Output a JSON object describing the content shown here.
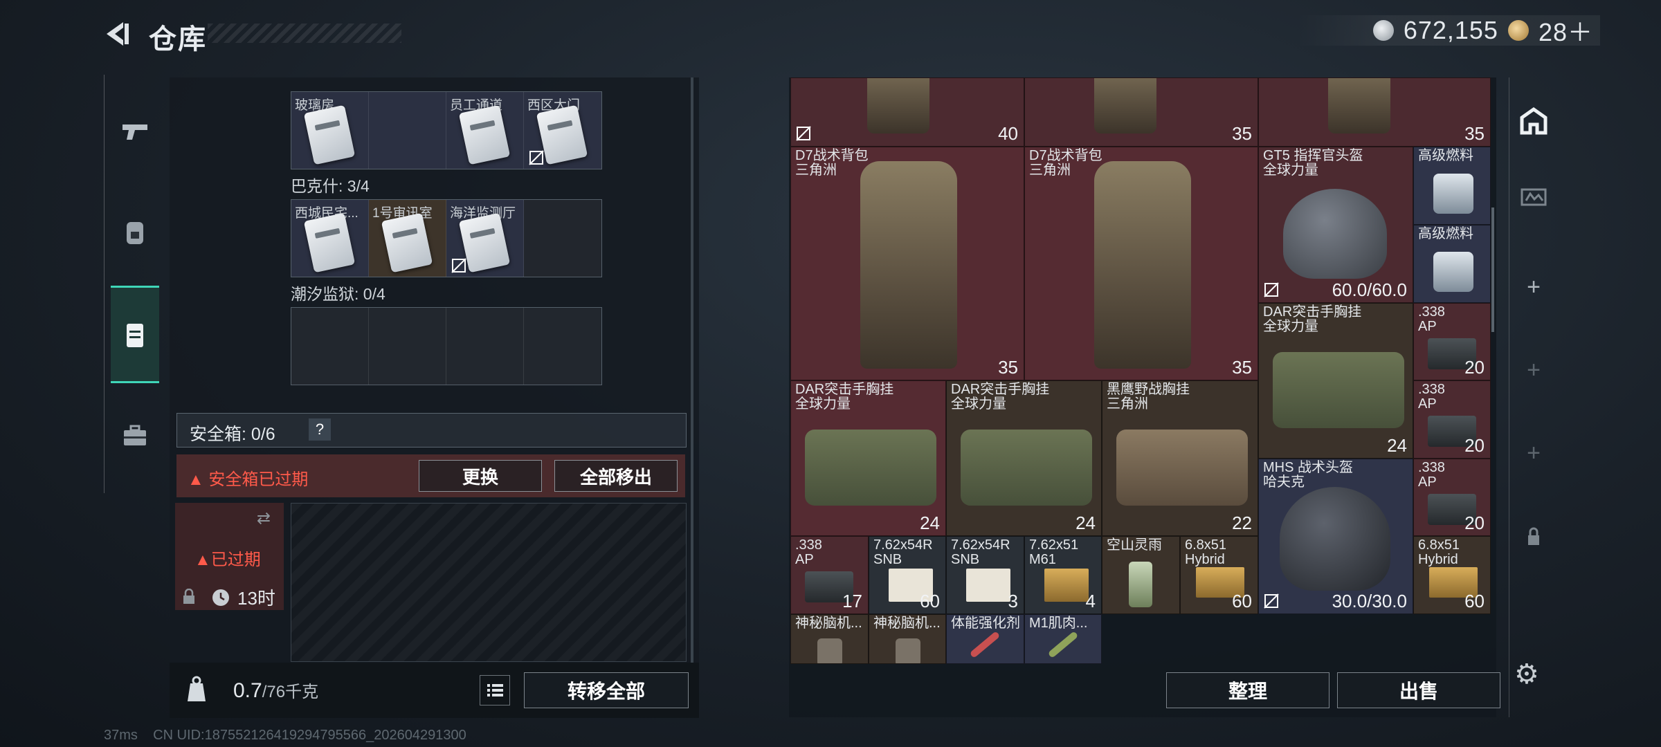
{
  "header": {
    "title": "仓库",
    "silver": "672,155",
    "gold": "28＋"
  },
  "left_rail": {
    "tabs": [
      "weapons",
      "backpack",
      "storage",
      "toolbox"
    ]
  },
  "storage": {
    "row0": [
      {
        "label": "玻璃房",
        "has_card": true,
        "style": "blue"
      },
      {
        "label": "",
        "has_card": false,
        "style": "blue"
      },
      {
        "label": "员工通道",
        "has_card": true,
        "style": "blue"
      },
      {
        "label": "西区大门",
        "has_card": true,
        "style": "blue",
        "nolock": true
      }
    ],
    "bakeshi_title": "巴克什: 3/4",
    "row1": [
      {
        "label": "西城民宅...",
        "has_card": true,
        "style": "blue"
      },
      {
        "label": "1号审讯室",
        "has_card": true,
        "style": "brown"
      },
      {
        "label": "海洋监测厅",
        "has_card": true,
        "style": "blue",
        "nolock": true
      },
      {
        "label": "",
        "has_card": false,
        "style": "blue"
      }
    ],
    "chaoxi_title": "潮汐监狱: 0/4"
  },
  "safe": {
    "title": "安全箱: 0/6",
    "help": "?",
    "expired_warning": "安全箱已过期",
    "replace": "更换",
    "move_all": "全部移出",
    "card_status": "已过期",
    "card_time": "13时"
  },
  "weight": {
    "current": "0.7",
    "max": "/76千克"
  },
  "transfer_all": "转移全部",
  "items": [
    {
      "name": "",
      "qty": "40"
    },
    {
      "name": "",
      "qty": "35"
    },
    {
      "name": "",
      "qty": "35"
    },
    {
      "name": "D7战术背包\n三角洲",
      "qty": "35"
    },
    {
      "name": "D7战术背包\n三角洲",
      "qty": "35"
    },
    {
      "name": "GT5 指挥官头盔\n全球力量",
      "qty": "60.0/60.0"
    },
    {
      "name": "高级燃料",
      "qty": ""
    },
    {
      "name": "高级燃料",
      "qty": ""
    },
    {
      "name": "DAR突击手胸挂\n全球力量",
      "qty": "24"
    },
    {
      "name": ".338\nAP",
      "qty": "20"
    },
    {
      "name": "DAR突击手胸挂\n全球力量",
      "qty": "24"
    },
    {
      "name": "DAR突击手胸挂\n全球力量",
      "qty": "24"
    },
    {
      "name": "黑鹰野战胸挂\n三角洲",
      "qty": "22"
    },
    {
      "name": ".338\nAP",
      "qty": "20"
    },
    {
      "name": "MHS 战术头盔\n哈夫克",
      "qty": "30.0/30.0"
    },
    {
      "name": ".338\nAP",
      "qty": "20"
    },
    {
      "name": ".338\nAP",
      "qty": "17"
    },
    {
      "name": "7.62x54R\nSNB",
      "qty": "60"
    },
    {
      "name": "7.62x54R\nSNB",
      "qty": "3"
    },
    {
      "name": "7.62x51\nM61",
      "qty": "4"
    },
    {
      "name": "空山灵雨",
      "qty": ""
    },
    {
      "name": "6.8x51\nHybrid",
      "qty": "60"
    },
    {
      "name": "6.8x51\nHybrid",
      "qty": "60"
    },
    {
      "name": "神秘脑机...",
      "qty": ""
    },
    {
      "name": "神秘脑机...",
      "qty": ""
    },
    {
      "name": "体能强化剂",
      "qty": ""
    },
    {
      "name": "M1肌肉...",
      "qty": ""
    }
  ],
  "actions": {
    "sort": "整理",
    "sell": "出售"
  },
  "status_bar": "37ms    CN UID:187552126419294795566_202604291300",
  "colors": {
    "accent": "#3fd6b8",
    "danger": "#ff5a4a"
  }
}
